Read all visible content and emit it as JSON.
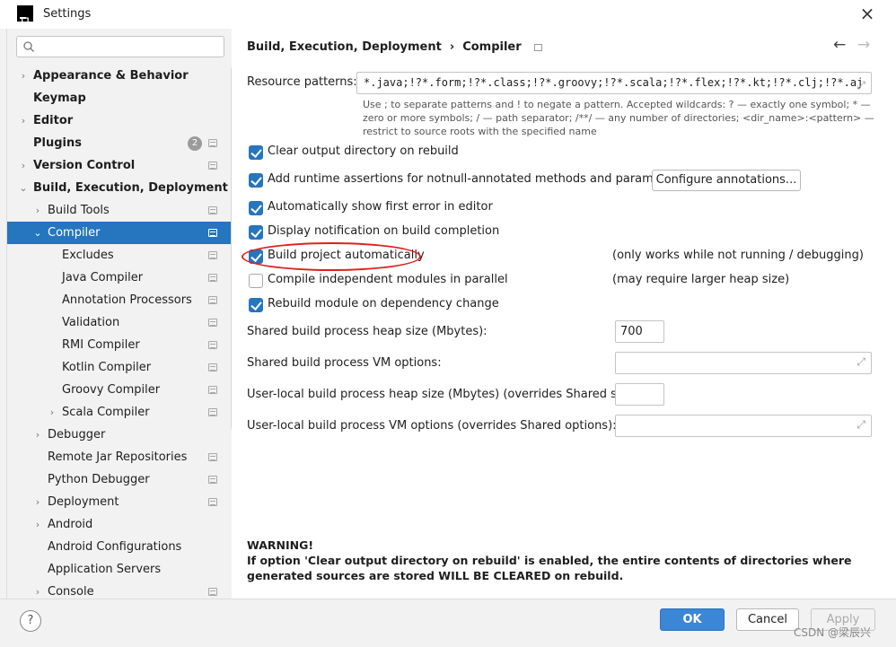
{
  "window": {
    "title": "Settings",
    "close_glyph": "×",
    "logo_text": "IJ"
  },
  "search": {
    "placeholder": ""
  },
  "tree": [
    {
      "label": "Appearance & Behavior",
      "bold": true,
      "arrow": "›",
      "level": 0,
      "page_icon": false
    },
    {
      "label": "Keymap",
      "bold": true,
      "arrow": "",
      "level": 0,
      "page_icon": false
    },
    {
      "label": "Editor",
      "bold": true,
      "arrow": "›",
      "level": 0,
      "page_icon": false
    },
    {
      "label": "Plugins",
      "bold": true,
      "arrow": "",
      "level": 0,
      "page_icon": true,
      "badge": "2"
    },
    {
      "label": "Version Control",
      "bold": true,
      "arrow": "›",
      "level": 0,
      "page_icon": true
    },
    {
      "label": "Build, Execution, Deployment",
      "bold": true,
      "arrow": "⌄",
      "level": 0,
      "page_icon": false
    },
    {
      "label": "Build Tools",
      "bold": false,
      "arrow": "›",
      "level": 1,
      "page_icon": true
    },
    {
      "label": "Compiler",
      "bold": false,
      "arrow": "⌄",
      "level": 1,
      "page_icon": true,
      "selected": true
    },
    {
      "label": "Excludes",
      "bold": false,
      "arrow": "",
      "level": 2,
      "page_icon": true
    },
    {
      "label": "Java Compiler",
      "bold": false,
      "arrow": "",
      "level": 2,
      "page_icon": true
    },
    {
      "label": "Annotation Processors",
      "bold": false,
      "arrow": "",
      "level": 2,
      "page_icon": true
    },
    {
      "label": "Validation",
      "bold": false,
      "arrow": "",
      "level": 2,
      "page_icon": true
    },
    {
      "label": "RMI Compiler",
      "bold": false,
      "arrow": "",
      "level": 2,
      "page_icon": true
    },
    {
      "label": "Kotlin Compiler",
      "bold": false,
      "arrow": "",
      "level": 2,
      "page_icon": true
    },
    {
      "label": "Groovy Compiler",
      "bold": false,
      "arrow": "",
      "level": 2,
      "page_icon": true
    },
    {
      "label": "Scala Compiler",
      "bold": false,
      "arrow": "›",
      "level": 2,
      "page_icon": true
    },
    {
      "label": "Debugger",
      "bold": false,
      "arrow": "›",
      "level": 1,
      "page_icon": false
    },
    {
      "label": "Remote Jar Repositories",
      "bold": false,
      "arrow": "",
      "level": 1,
      "page_icon": true
    },
    {
      "label": "Python Debugger",
      "bold": false,
      "arrow": "",
      "level": 1,
      "page_icon": true
    },
    {
      "label": "Deployment",
      "bold": false,
      "arrow": "›",
      "level": 1,
      "page_icon": true
    },
    {
      "label": "Android",
      "bold": false,
      "arrow": "›",
      "level": 1,
      "page_icon": false
    },
    {
      "label": "Android Configurations",
      "bold": false,
      "arrow": "",
      "level": 1,
      "page_icon": false
    },
    {
      "label": "Application Servers",
      "bold": false,
      "arrow": "",
      "level": 1,
      "page_icon": false
    },
    {
      "label": "Console",
      "bold": false,
      "arrow": "›",
      "level": 1,
      "page_icon": true
    }
  ],
  "breadcrumb": {
    "parent": "Build, Execution, Deployment",
    "separator": "›",
    "current": "Compiler"
  },
  "nav": {
    "back": "←",
    "forward": "→"
  },
  "resource_patterns": {
    "label": "Resource patterns:",
    "value": "*.java;!?*.form;!?*.class;!?*.groovy;!?*.scala;!?*.flex;!?*.kt;!?*.clj;!?*.aj",
    "hint": "Use ; to separate patterns and ! to negate a pattern. Accepted wildcards: ? — exactly one symbol; * — zero or more symbols; / — path separator; /**/ — any number of directories; <dir_name>:<pattern> — restrict to source roots with the specified name"
  },
  "checkboxes": {
    "clear_output": {
      "label": "Clear output directory on rebuild",
      "checked": true
    },
    "runtime_assertions": {
      "label": "Add runtime assertions for notnull-annotated methods and parameters",
      "checked": true
    },
    "show_first_error": {
      "label": "Automatically show first error in editor",
      "checked": true
    },
    "display_notification": {
      "label": "Display notification on build completion",
      "checked": true
    },
    "build_automatically": {
      "label": "Build project automatically",
      "checked": true,
      "note": "(only works while not running / debugging)"
    },
    "compile_parallel": {
      "label": "Compile independent modules in parallel",
      "checked": false,
      "note": "(may require larger heap size)"
    },
    "rebuild_module": {
      "label": "Rebuild module on dependency change",
      "checked": true
    }
  },
  "configure_annotations_label": "Configure annotations...",
  "heap_size": {
    "label": "Shared build process heap size (Mbytes):",
    "value": "700"
  },
  "vm_options": {
    "label": "Shared build process VM options:",
    "value": ""
  },
  "user_heap": {
    "label": "User-local build process heap size (Mbytes) (overrides Shared size):",
    "value": ""
  },
  "user_vm": {
    "label": "User-local build process VM options (overrides Shared options):",
    "value": ""
  },
  "warning": {
    "title": "WARNING!",
    "text": "If option 'Clear output directory on rebuild' is enabled, the entire contents of directories where generated sources are stored WILL BE CLEARED on rebuild."
  },
  "buttons": {
    "help": "?",
    "ok": "OK",
    "cancel": "Cancel",
    "apply": "Apply"
  },
  "watermark": "CSDN @梁辰兴",
  "colors": {
    "accent": "#2675bf",
    "highlight_circle": "#e02020"
  }
}
